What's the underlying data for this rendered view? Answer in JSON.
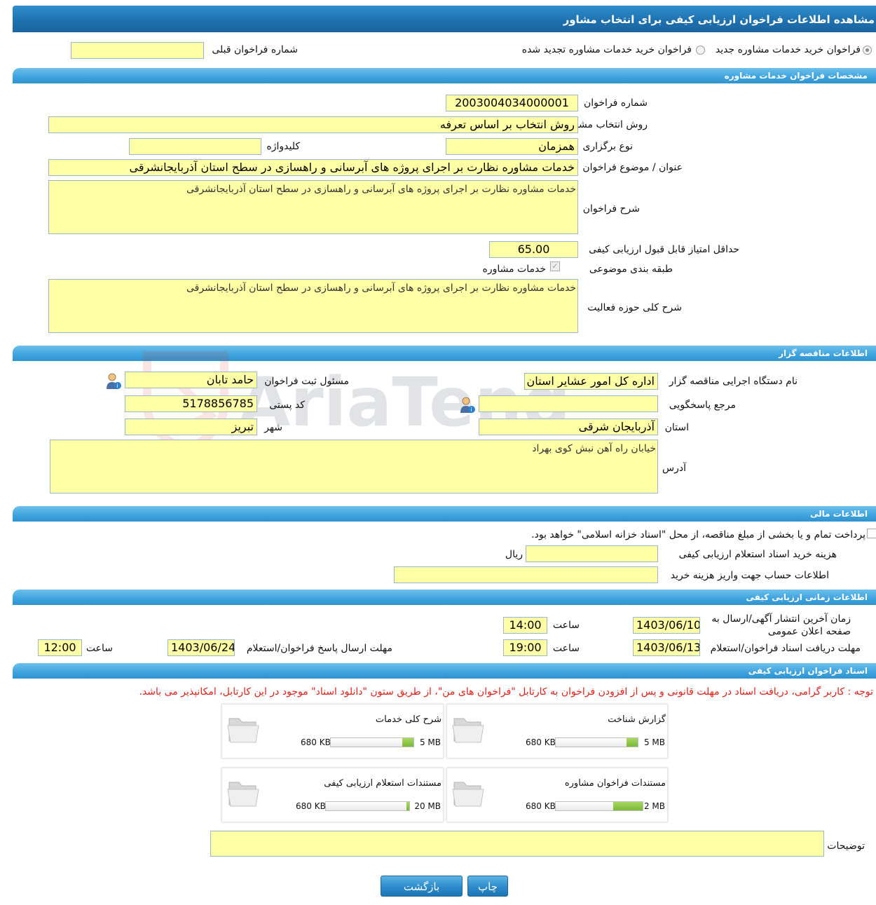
{
  "page_title": "مشاهده اطلاعات فراخوان ارزیابی کیفی برای انتخاب مشاور",
  "radios": {
    "new_label": "فراخوان خرید خدمات مشاوره جدید",
    "renewed_label": "فراخوان خرید خدمات مشاوره تجدید شده",
    "prev_number_label": "شماره فراخوان قبلی",
    "prev_number_value": ""
  },
  "sections": {
    "specs": "مشخصات فراخوان خدمات مشاوره",
    "tenderer": "اطلاعات مناقصه گزار",
    "financial": "اطلاعات مالی",
    "timing": "اطلاعات زمانی ارزیابی کیفی",
    "documents": "اسناد فراخوان ارزیابی کیفی"
  },
  "specs": {
    "number_label": "شماره فراخوان",
    "number_value": "2003004034000001",
    "method_label": "روش انتخاب مشاور",
    "method_value": "روش انتخاب بر اساس تعرفه",
    "holding_type_label": "نوع برگزاری",
    "holding_type_value": "همزمان",
    "keyword_label": "کلیدواژه",
    "keyword_value": "",
    "subject_label": "عنوان / موضوع فراخوان",
    "subject_value": "خدمات مشاوره نظارت بر اجرای پروژه های آبرسانی و راهسازی در سطح استان آذربایجانشرقی",
    "description_label": "شرح فراخوان",
    "description_value": "خدمات مشاوره نظارت بر اجرای پروژه های آبرسانی و راهسازی در سطح استان آذربایجانشرقی",
    "min_score_label": "حداقل امتیاز قابل قبول ارزیابی کیفی",
    "min_score_value": "65.00",
    "category_label": "طبقه بندی موضوعی",
    "category_value": "خدمات مشاوره",
    "activity_label": "شرح کلی حوزه فعالیت",
    "activity_value": "خدمات مشاوره نظارت بر اجرای پروژه های آبرسانی و راهسازی در سطح استان آذربایجانشرقی"
  },
  "tenderer": {
    "org_label": "نام دستگاه اجرایی مناقصه گزار",
    "org_value": "اداره کل امور عشایر استان",
    "registrar_label": "مسئول ثبت فراخوان",
    "registrar_value": "حامد تابان",
    "reference_label": "مرجع پاسخگویی",
    "reference_value": "",
    "postal_label": "کد پستی",
    "postal_value": "5178856785",
    "province_label": "استان",
    "province_value": "آذربایجان شرقی",
    "city_label": "شهر",
    "city_value": "تبریز",
    "address_label": "آدرس",
    "address_value": "خیابان راه آهن نبش کوی بهراد"
  },
  "financial": {
    "treasury_text": "پرداخت تمام و یا بخشی از مبلغ مناقصه، از محل \"اسناد خزانه اسلامی\" خواهد بود.",
    "doc_cost_label": "هزینه خرید اسناد استعلام ارزیابی کیفی",
    "doc_cost_value": "",
    "currency": "ریال",
    "account_label": "اطلاعات حساب جهت واریز هزینه خرید",
    "account_value": ""
  },
  "timing": {
    "publish_label": "زمان آخرین انتشار آگهی/ارسال به صفحه اعلان عمومی",
    "publish_date": "1403/06/10",
    "time_label": "ساعت",
    "publish_time": "14:00",
    "receive_deadline_label": "مهلت دریافت اسناد فراخوان/استعلام",
    "receive_date": "1403/06/13",
    "receive_time": "19:00",
    "send_deadline_label": "مهلت ارسال پاسخ فراخوان/استعلام",
    "send_date": "1403/06/24",
    "send_time": "12:00"
  },
  "documents": {
    "note": "توجه : کاربر گرامی، دریافت اسناد در مهلت قانونی و پس از افزودن فراخوان به کارتابل \"فراخوان های من\"، از طریق ستون \"دانلود اسناد\" موجود در این کارتابل، امکانپذیر می باشد.",
    "files": [
      {
        "title": "گزارش شناخت",
        "size": "680 KB",
        "max": "5 MB",
        "fill": 0.133
      },
      {
        "title": "شرح کلی خدمات",
        "size": "680 KB",
        "max": "5 MB",
        "fill": 0.133
      },
      {
        "title": "مستندات فراخوان مشاوره",
        "size": "680 KB",
        "max": "2 MB",
        "fill": 0.34
      },
      {
        "title": "مستندات استعلام ارزیابی کیفی",
        "size": "680 KB",
        "max": "20 MB",
        "fill": 0.034
      }
    ],
    "notes_label": "توضیحات",
    "notes_value": ""
  },
  "buttons": {
    "print": "چاپ",
    "back": "بازگشت"
  },
  "watermark_text": "AriaTender.neT",
  "colors": {
    "header_blue": "#1f72b0",
    "section_blue": "#3ea2dc",
    "field_yellow": "#ffffa6",
    "note_red": "#e1201a",
    "progress_green": "#7ab93a"
  }
}
